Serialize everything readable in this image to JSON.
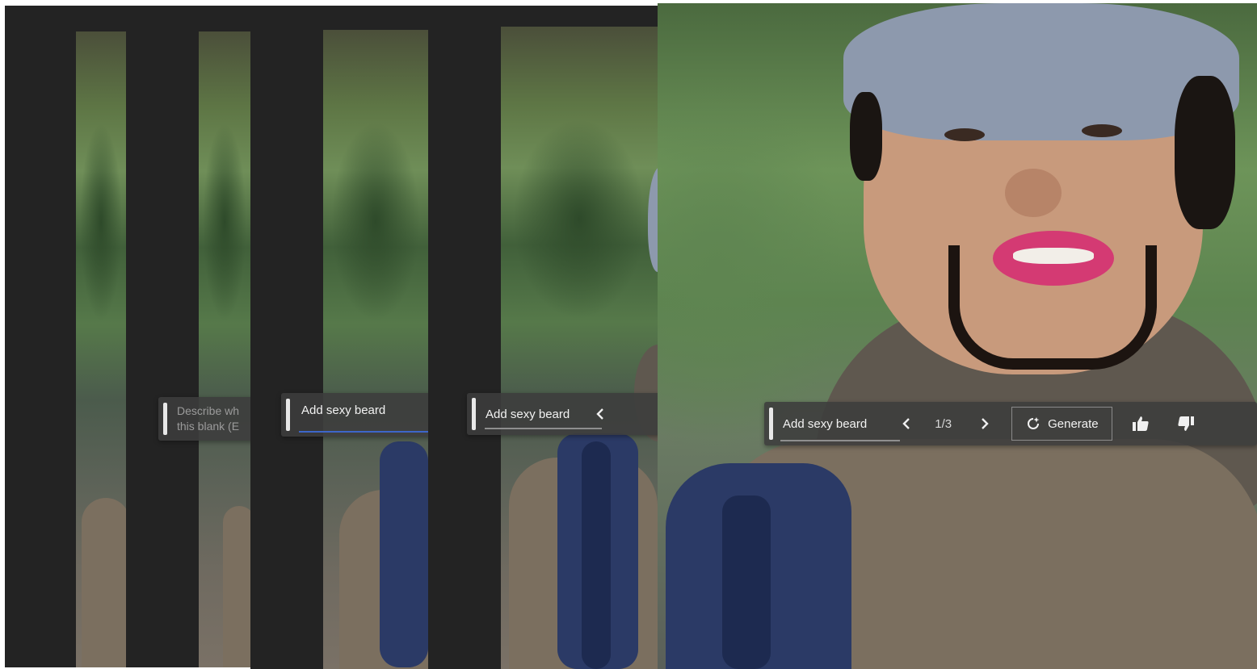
{
  "prompt_panel": {
    "placeholder_line1": "Describe wh",
    "placeholder_line2": "this blank (E",
    "value": "Add sexy beard"
  },
  "toolbar": {
    "prev_icon": "chevron-left-icon",
    "next_icon": "chevron-right-icon",
    "counter": "1/3",
    "generate_label": "Generate",
    "generate_icon": "refresh-sparkle-icon",
    "like_icon": "thumbs-up-icon",
    "dislike_icon": "thumbs-down-icon"
  },
  "colors": {
    "accent_underline": "#3d66c9",
    "toolbar_bg": "#3c3c3c",
    "lipstick": "#d43a73"
  }
}
